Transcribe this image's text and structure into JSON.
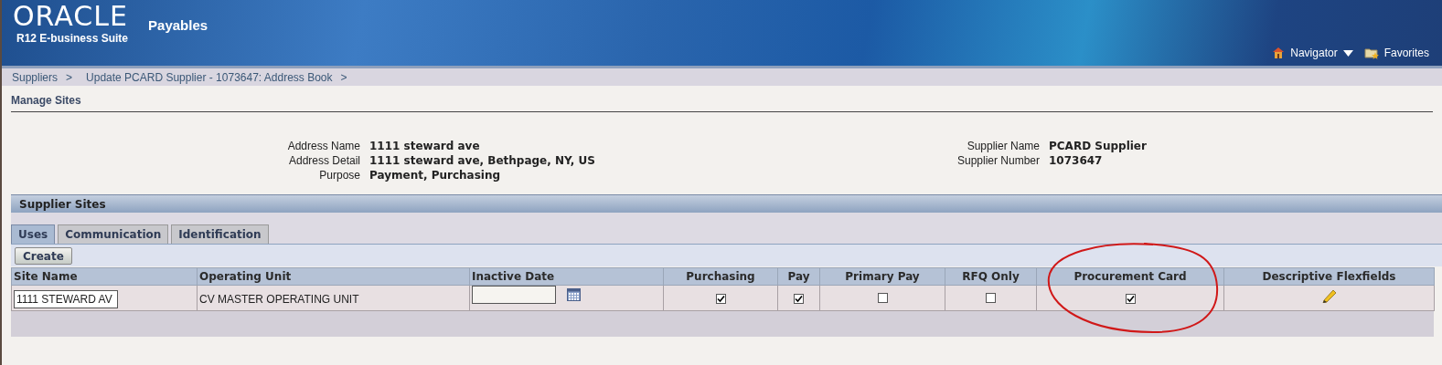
{
  "header": {
    "logo": "ORACLE",
    "suite": "R12 E-business Suite",
    "app": "Payables",
    "links": [
      {
        "label": "Navigator",
        "kind": "home"
      },
      {
        "label": "Favorites",
        "kind": "favorites"
      }
    ]
  },
  "breadcrumbs": [
    {
      "label": "Suppliers",
      "separator": ">"
    },
    {
      "label": "Update PCARD Supplier - 1073647: Address Book",
      "separator": ">"
    }
  ],
  "page_title": "Manage Sites",
  "details_left": [
    {
      "label": "Address Name",
      "value": "1111 steward ave"
    },
    {
      "label": "Address Detail",
      "value": "1111 steward ave, Bethpage, NY, US"
    },
    {
      "label": "Purpose",
      "value": "Payment, Purchasing"
    }
  ],
  "details_right": [
    {
      "label": "Supplier Name",
      "value": "PCARD Supplier"
    },
    {
      "label": "Supplier Number",
      "value": "1073647"
    }
  ],
  "section_title": "Supplier Sites",
  "tabs": [
    {
      "label": "Uses",
      "selected": true
    },
    {
      "label": "Communication",
      "selected": false
    },
    {
      "label": "Identification",
      "selected": false
    }
  ],
  "create_button": "Create",
  "table": {
    "columns": [
      {
        "label": "Site Name"
      },
      {
        "label": "Operating Unit"
      },
      {
        "label": "Inactive Date"
      },
      {
        "label": "Purchasing"
      },
      {
        "label": "Pay"
      },
      {
        "label": "Primary Pay"
      },
      {
        "label": "RFQ Only"
      },
      {
        "label": "Procurement Card",
        "circled": true
      },
      {
        "label": "Descriptive Flexfields"
      }
    ],
    "rows": [
      [
        {
          "kind": "input",
          "value": "1111 STEWARD AV"
        },
        {
          "kind": "text",
          "value": "CV MASTER OPERATING UNIT"
        },
        {
          "kind": "date"
        },
        {
          "kind": "checkbox",
          "checked": true
        },
        {
          "kind": "checkbox",
          "checked": true
        },
        {
          "kind": "checkbox",
          "checked": false
        },
        {
          "kind": "checkbox",
          "checked": false
        },
        {
          "kind": "checkbox",
          "checked": true
        },
        {
          "kind": "edit"
        }
      ]
    ]
  }
}
